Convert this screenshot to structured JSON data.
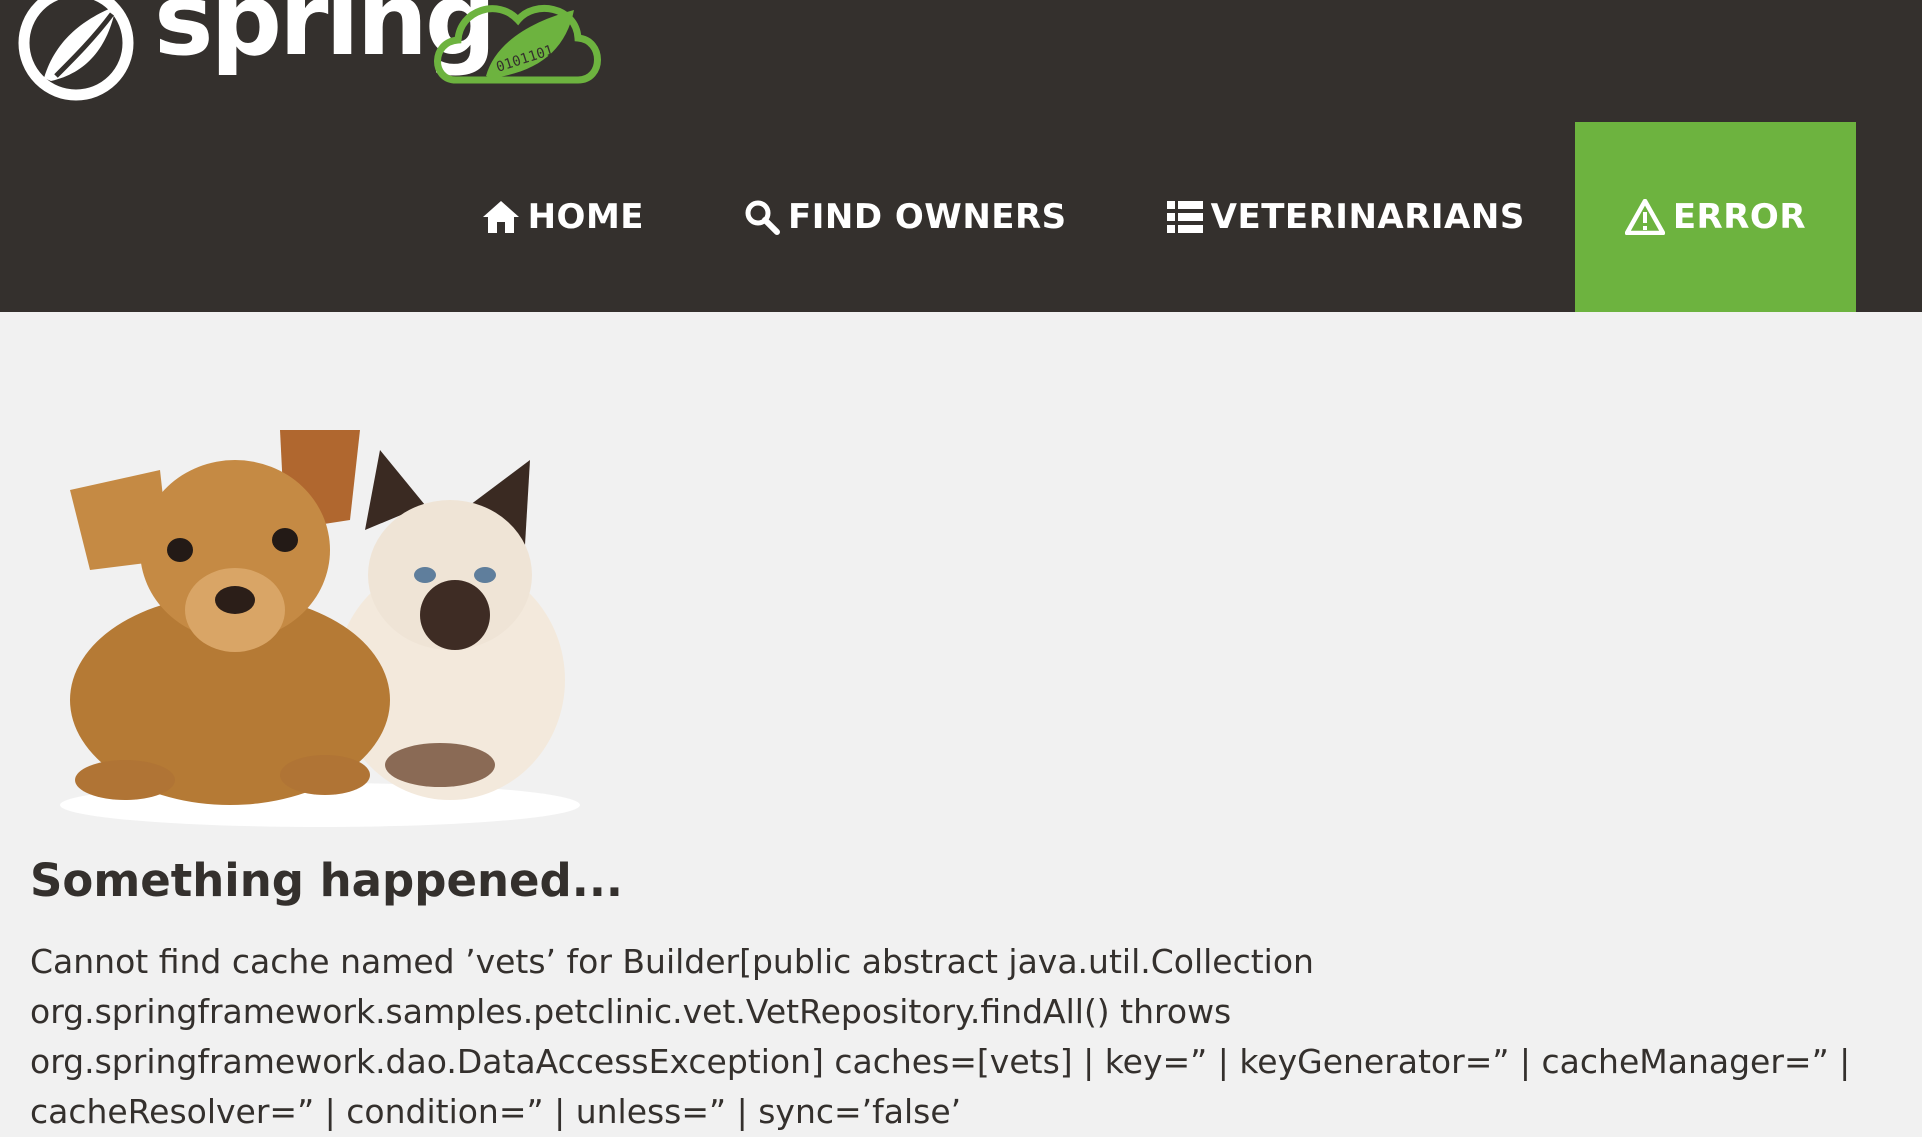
{
  "brand": {
    "name": "spring",
    "cloud_digits": "0101101"
  },
  "nav": {
    "items": [
      {
        "label": "HOME",
        "icon": "home-icon"
      },
      {
        "label": "FIND OWNERS",
        "icon": "search-icon"
      },
      {
        "label": "VETERINARIANS",
        "icon": "list-icon"
      },
      {
        "label": "ERROR",
        "icon": "warning-icon",
        "active": true
      }
    ],
    "active_color": "#6db33f"
  },
  "colors": {
    "header_bg": "#34302d",
    "page_bg": "#f1f1f1",
    "text": "#34302d"
  },
  "error": {
    "title": "Something happened...",
    "message": "Cannot find cache named ’vets’ for Builder[public abstract java.util.Collection org.springframework.samples.petclinic.vet.VetRepository.findAll() throws org.springframework.dao.DataAccessException] caches=[vets] | key=” | keyGenerator=” | cacheManager=” | cacheResolver=” | condition=” | unless=” | sync=’false’"
  }
}
